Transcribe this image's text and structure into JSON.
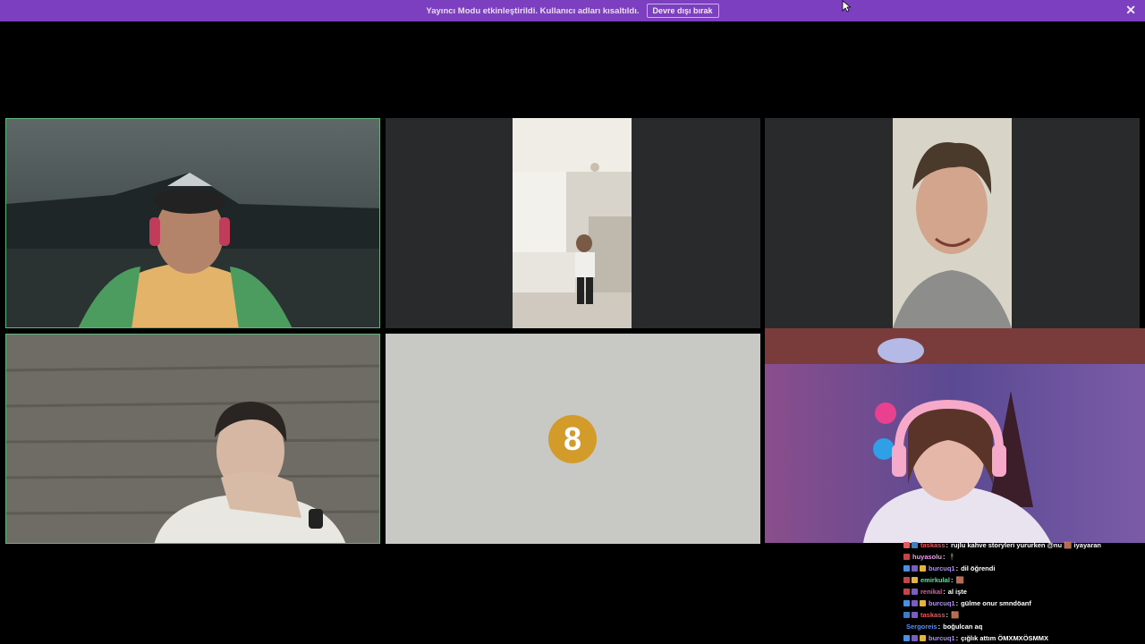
{
  "banner": {
    "message": "Yayıncı Modu etkinleştirildi. Kullanıcı adları kısaltıldı.",
    "button_label": "Devre dışı bırak",
    "close_glyph": "✕"
  },
  "tiles": [
    {
      "id": "participant-1",
      "active": true
    },
    {
      "id": "participant-2",
      "active": false
    },
    {
      "id": "participant-3",
      "active": false
    },
    {
      "id": "participant-4",
      "active": true
    },
    {
      "id": "participant-5",
      "placeholder_number": "8"
    },
    {
      "id": "participant-6-stream",
      "active": false
    }
  ],
  "chat": {
    "messages": [
      {
        "user": "taskass",
        "user_color": "#e35a5a",
        "text": "rujlu kahve storyleri yururken @nu 🟫 iyayaran",
        "badges": [
          "#e35a5a",
          "#3d7cc9"
        ]
      },
      {
        "user": "huyasolu",
        "user_color": "#e8a3e8",
        "text": "🕴️",
        "badges": [
          "#c04747"
        ]
      },
      {
        "user": "burcuq1",
        "user_color": "#b48cff",
        "text": "dil öğrendi",
        "badges": [
          "#4a90e2",
          "#7a5bc7",
          "#e3b33c"
        ]
      },
      {
        "user": "emirkulal",
        "user_color": "#66d8a3",
        "text": "🟫",
        "badges": [
          "#c04747",
          "#e3b33c"
        ]
      },
      {
        "user": "renikal",
        "user_color": "#e05ca6",
        "text": "al işte",
        "badges": [
          "#c04747",
          "#7a5bc7"
        ]
      },
      {
        "user": "burcuq1",
        "user_color": "#b48cff",
        "text": "gülme onur smndöanf",
        "badges": [
          "#4a90e2",
          "#7a5bc7",
          "#e3b33c"
        ]
      },
      {
        "user": "taskass",
        "user_color": "#e35a5a",
        "text": "🟫",
        "badges": [
          "#3d7cc9",
          "#7a5bc7"
        ]
      },
      {
        "user": "Sergoreis",
        "user_color": "#5b8cf0",
        "text": "boğulcan aq",
        "badges": []
      },
      {
        "user": "burcuq1",
        "user_color": "#b48cff",
        "text": "çığlık attım ÖMXMXÖSMMX",
        "badges": [
          "#4a90e2",
          "#7a5bc7",
          "#e3b33c"
        ]
      }
    ]
  },
  "colors": {
    "banner_bg": "#7c3fc0",
    "active_border": "#5fb37c",
    "tile_bg": "#282a2c",
    "placeholder_circle": "#d39b2a"
  }
}
